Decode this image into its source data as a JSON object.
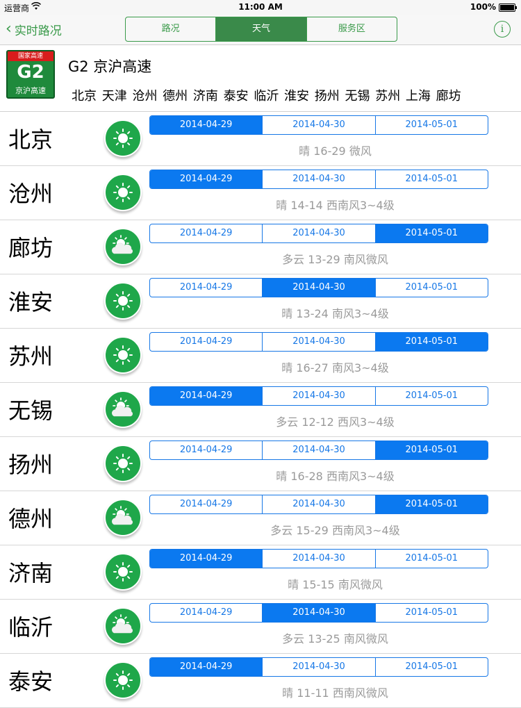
{
  "status": {
    "carrier": "运营商",
    "time": "11:00 AM",
    "battery": "100%"
  },
  "nav": {
    "back_label": "实时路况",
    "segments": [
      "路况",
      "天气",
      "服务区"
    ],
    "active_segment": 1,
    "info_label": "i"
  },
  "highway": {
    "sign_top": "国家高速",
    "sign_code": "G2",
    "sign_name": "京沪高速",
    "title": "G2 京沪高速",
    "cities": "北京 天津 沧州 德州 济南 泰安 临沂 淮安 扬州 无锡 苏州 上海 廊坊"
  },
  "dates": [
    "2014-04-29",
    "2014-04-30",
    "2014-05-01"
  ],
  "rows": [
    {
      "city": "北京",
      "icon": "sun-icon",
      "selected": 0,
      "desc": "晴 16-29 微风"
    },
    {
      "city": "沧州",
      "icon": "sun-icon",
      "selected": 0,
      "desc": "晴 14-14 西南风3~4级"
    },
    {
      "city": "廊坊",
      "icon": "cloudy-icon",
      "selected": 2,
      "desc": "多云 13-29 南风微风"
    },
    {
      "city": "淮安",
      "icon": "sun-icon",
      "selected": 1,
      "desc": "晴 13-24 南风3~4级"
    },
    {
      "city": "苏州",
      "icon": "sun-icon",
      "selected": 2,
      "desc": "晴 16-27 南风3~4级"
    },
    {
      "city": "无锡",
      "icon": "cloudy-icon",
      "selected": 0,
      "desc": "多云 12-12 西风3~4级"
    },
    {
      "city": "扬州",
      "icon": "sun-icon",
      "selected": 2,
      "desc": "晴 16-28 西南风3~4级"
    },
    {
      "city": "德州",
      "icon": "cloudy-icon",
      "selected": 2,
      "desc": "多云 15-29 西南风3~4级"
    },
    {
      "city": "济南",
      "icon": "sun-icon",
      "selected": 0,
      "desc": "晴 15-15 南风微风"
    },
    {
      "city": "临沂",
      "icon": "cloudy-icon",
      "selected": 1,
      "desc": "多云 13-25 南风微风"
    },
    {
      "city": "泰安",
      "icon": "sun-icon",
      "selected": 0,
      "desc": "晴 11-11 西南风微风"
    }
  ],
  "colors": {
    "green": "#1fa74a",
    "blue": "#0b79f0",
    "red": "#d81c1c"
  }
}
